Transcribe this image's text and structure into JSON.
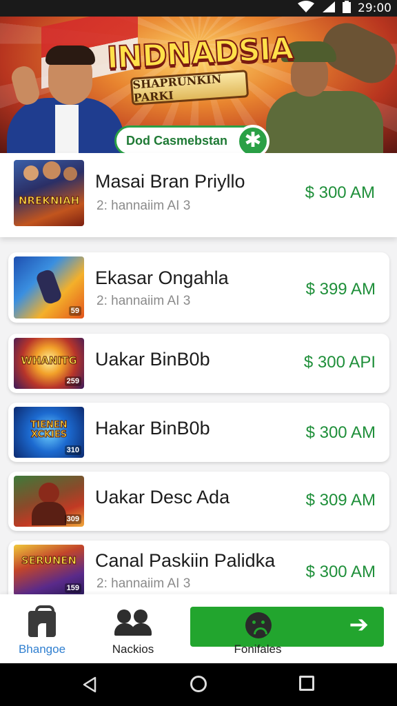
{
  "status_bar": {
    "time": "29:00",
    "wifi_icon": "wifi-icon",
    "signal_icon": "signal-icon",
    "battery_icon": "battery-icon"
  },
  "banner": {
    "title": "INDNADSIA",
    "subtitle": "SHAPRUNKIN PARKI",
    "cta_label": "Dod Casmebstan",
    "cta_icon": "asterisk-icon"
  },
  "items": [
    {
      "title": "Masai Bran Priyllo",
      "subtitle": "2: hannaiim AI 3",
      "price": "$ 300  AM",
      "thumb_text": "NREKNIAH",
      "thumb_badge": ""
    },
    {
      "title": "Ekasar Ongahla",
      "subtitle": "2: hannaiim AI 3",
      "price": "$ 399  AM",
      "thumb_text": "",
      "thumb_badge": "59"
    },
    {
      "title": "Uakar BinB0b",
      "subtitle": "",
      "price": "$ 300  API",
      "thumb_text": "WHANITG",
      "thumb_badge": "259"
    },
    {
      "title": "Hakar BinB0b",
      "subtitle": "",
      "price": "$ 300  AM",
      "thumb_text": "TIENEN XCKIES",
      "thumb_badge": "310"
    },
    {
      "title": "Uakar Desc  Ada",
      "subtitle": "",
      "price": "$ 309  AM",
      "thumb_text": "",
      "thumb_badge": "309"
    },
    {
      "title": "Canal Paskiin Palidka",
      "subtitle": "2: hannaiim AI 3",
      "price": "$ 300  AM",
      "thumb_text": "SERUNEN",
      "thumb_badge": "159"
    }
  ],
  "bottom_nav": {
    "items": [
      {
        "label": "Bhangoe",
        "icon": "bag-icon",
        "active": true
      },
      {
        "label": "Nackios",
        "icon": "people-icon",
        "active": false
      },
      {
        "label": "Fonifales",
        "icon": "sad-face-icon",
        "active": false
      }
    ],
    "arrow_icon": "arrow-right-icon"
  },
  "colors": {
    "accent_green": "#22a52e",
    "price_green": "#1f8f3a",
    "active_blue": "#2f7fd0"
  },
  "system_nav": {
    "back_icon": "back-icon",
    "home_icon": "home-icon",
    "recents_icon": "recents-icon"
  }
}
